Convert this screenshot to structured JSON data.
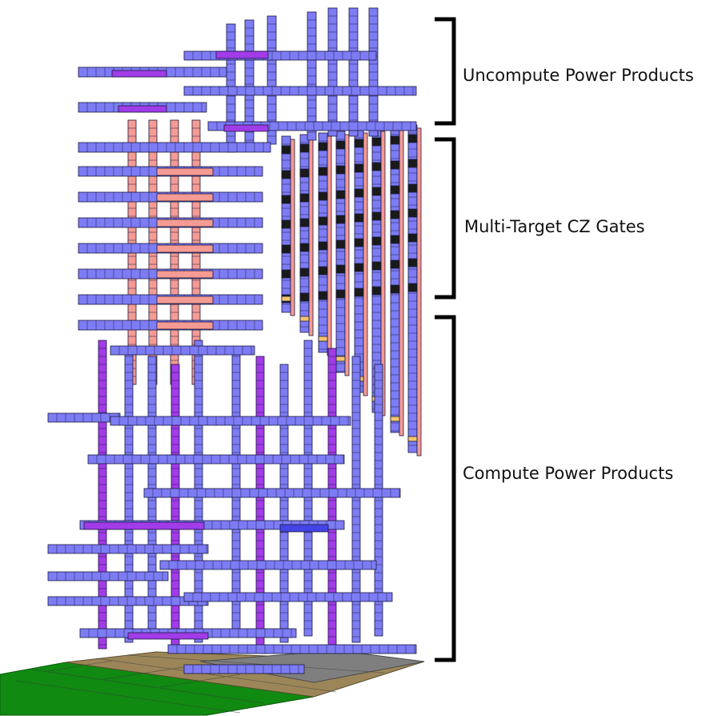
{
  "sections": [
    {
      "label": "Uncompute Power Products"
    },
    {
      "label": "Multi-Target CZ Gates"
    },
    {
      "label": "Compute Power Products"
    }
  ],
  "colors": {
    "qubit_blue": "#7d7cf5",
    "qubit_blue_dark": "#4444e6",
    "route_pink": "#f59b93",
    "route_magenta": "#a23be8",
    "gate_black": "#1a1a1a",
    "tile_green": "#108a10",
    "tile_tan": "#9c8659",
    "tile_gray": "#7f7f7f",
    "highlight_yellow": "#f5c46b"
  }
}
